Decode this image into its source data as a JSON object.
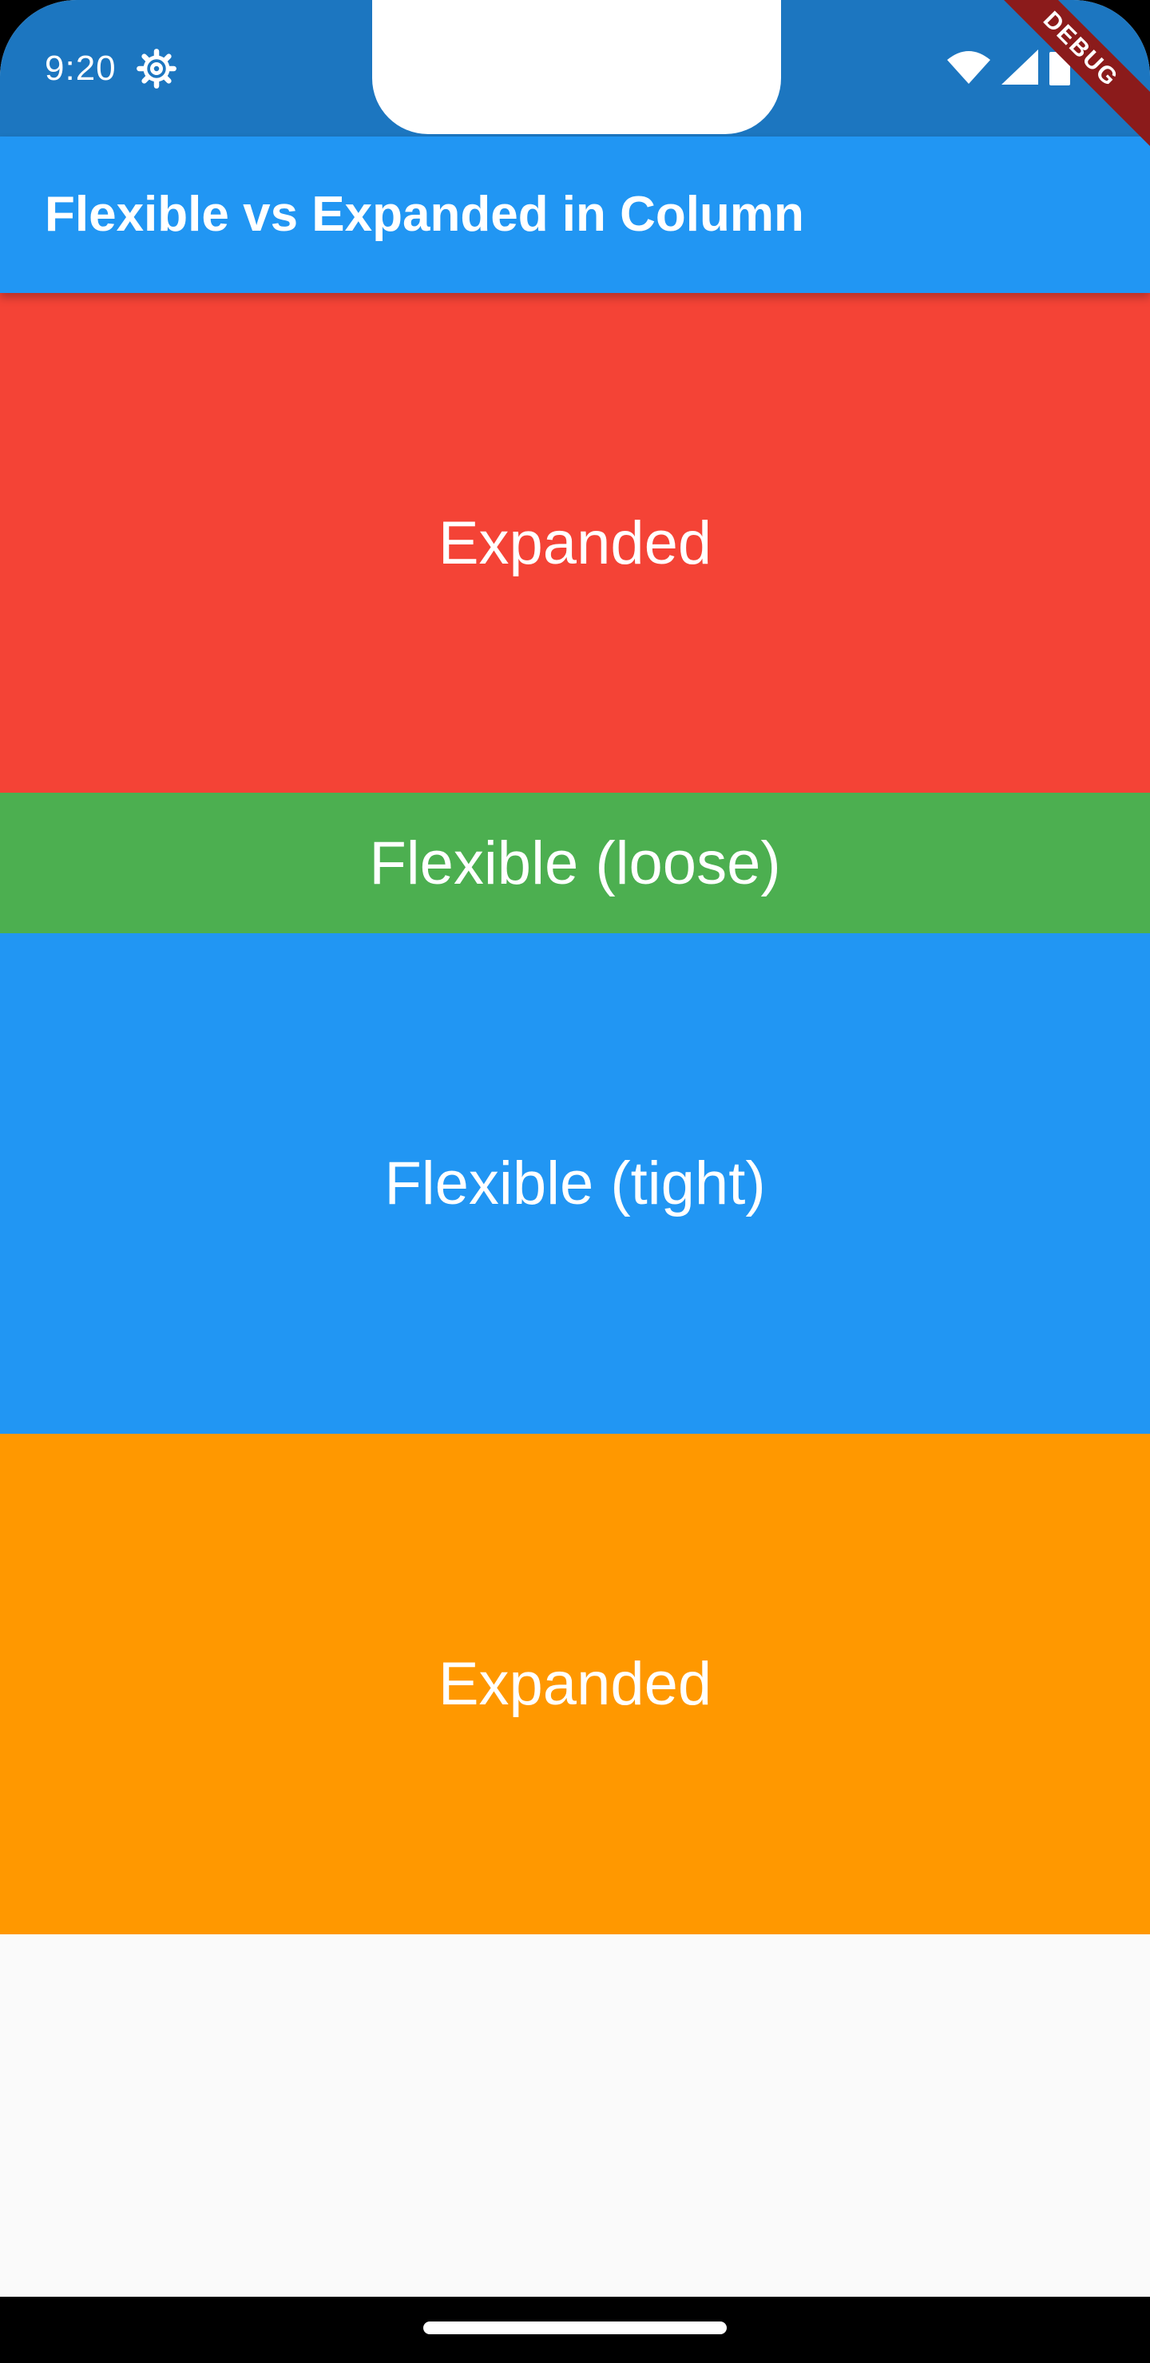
{
  "status_bar": {
    "time": "9:20",
    "icons": [
      "settings-gear-icon",
      "wifi-icon",
      "cellular-signal-icon",
      "battery-icon"
    ],
    "background": "#1c76c0"
  },
  "debug_banner": {
    "label": "DEBUG",
    "color": "#8b1b1b"
  },
  "app_bar": {
    "title": "Flexible vs Expanded in Column",
    "background": "#2196f3"
  },
  "blocks": [
    {
      "label": "Expanded",
      "color": "#f44336"
    },
    {
      "label": "Flexible (loose)",
      "color": "#4caf50"
    },
    {
      "label": "Flexible (tight)",
      "color": "#2196f3"
    },
    {
      "label": "Expanded",
      "color": "#ff9800"
    }
  ],
  "colors": {
    "scaffold_background": "#fafafa",
    "nav_bar": "#000000",
    "text": "#ffffff"
  }
}
